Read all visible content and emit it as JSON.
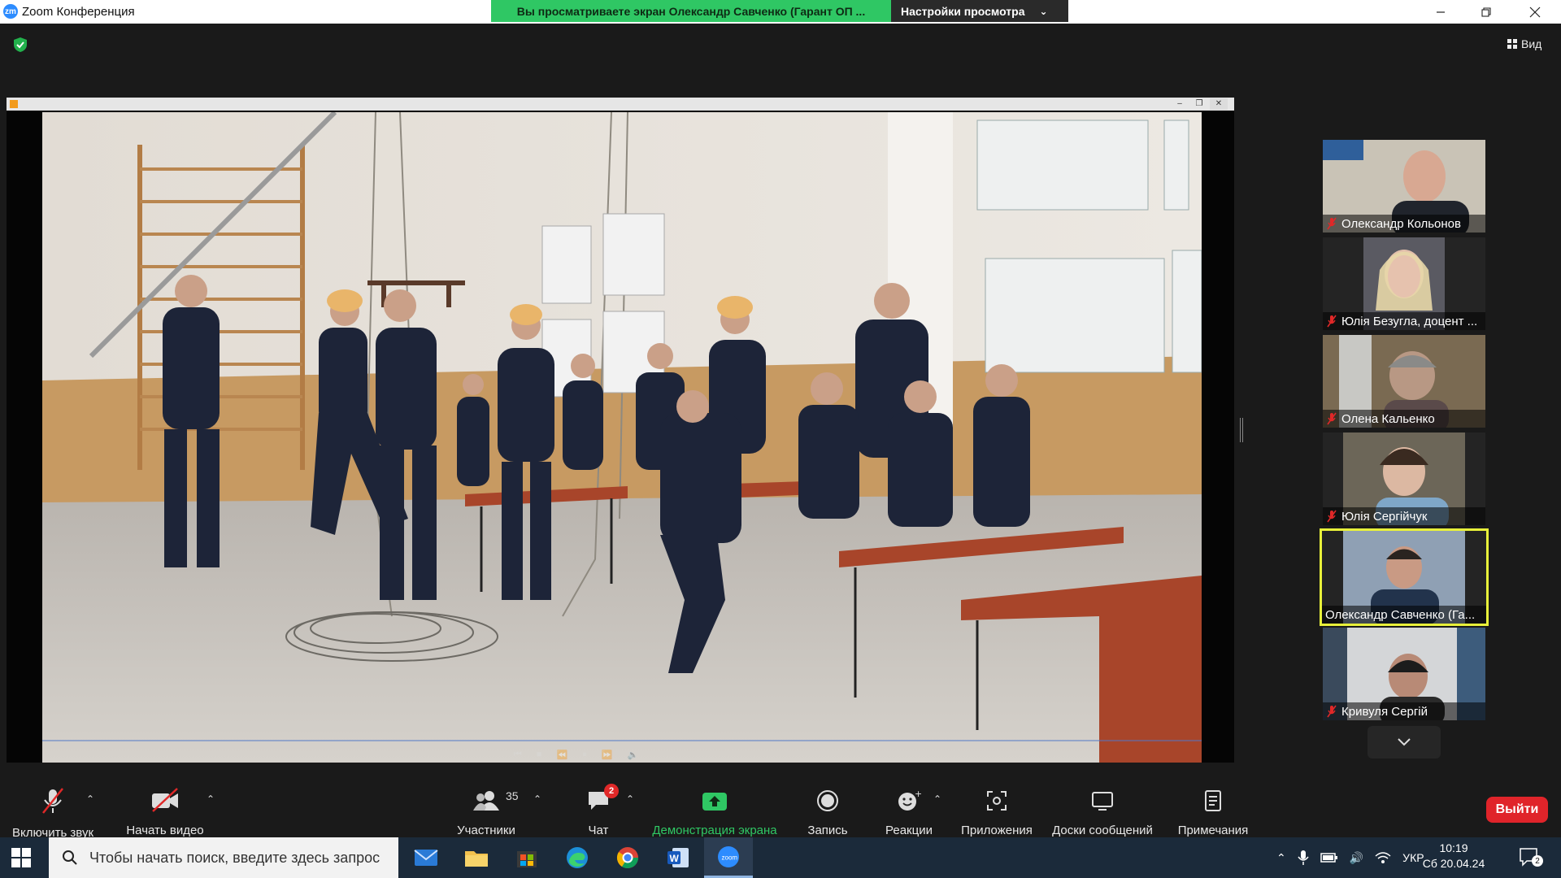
{
  "titlebar": {
    "app_logo": "zm",
    "app_title": "Zoom Конференция",
    "share_banner": "Вы просматриваете экран Олександр Савченко (Гарант ОП ...",
    "view_settings_label": "Настройки просмотра"
  },
  "meeting": {
    "view_label": "Вид"
  },
  "participants": [
    {
      "name": "Олександр Кольонов",
      "muted": true
    },
    {
      "name": "Юлія Безугла, доцент ...",
      "muted": true
    },
    {
      "name": "Олена Кальенко",
      "muted": true
    },
    {
      "name": "Юлія Сергійчук",
      "muted": true
    },
    {
      "name": "Олександр Савченко (Га...",
      "muted": false,
      "active": true
    },
    {
      "name": "Кривуля Сергій",
      "muted": true
    }
  ],
  "toolbar": {
    "audio_label": "Включить звук",
    "video_label": "Начать видео",
    "participants_label": "Участники",
    "participants_count": "35",
    "chat_label": "Чат",
    "chat_badge": "2",
    "share_label": "Демонстрация экрана",
    "record_label": "Запись",
    "reactions_label": "Реакции",
    "apps_label": "Приложения",
    "whiteboards_label": "Доски сообщений",
    "notes_label": "Примечания",
    "leave_label": "Выйти"
  },
  "taskbar": {
    "search_placeholder": "Чтобы начать поиск, введите здесь запрос",
    "language": "УКР",
    "time": "10:19",
    "date": "Сб 20.04.24",
    "notifications": "2"
  },
  "colors": {
    "share_green": "#2fc764",
    "active_speaker": "#e8f03a",
    "leave_red": "#e0242a",
    "muted_red": "#e02828"
  }
}
